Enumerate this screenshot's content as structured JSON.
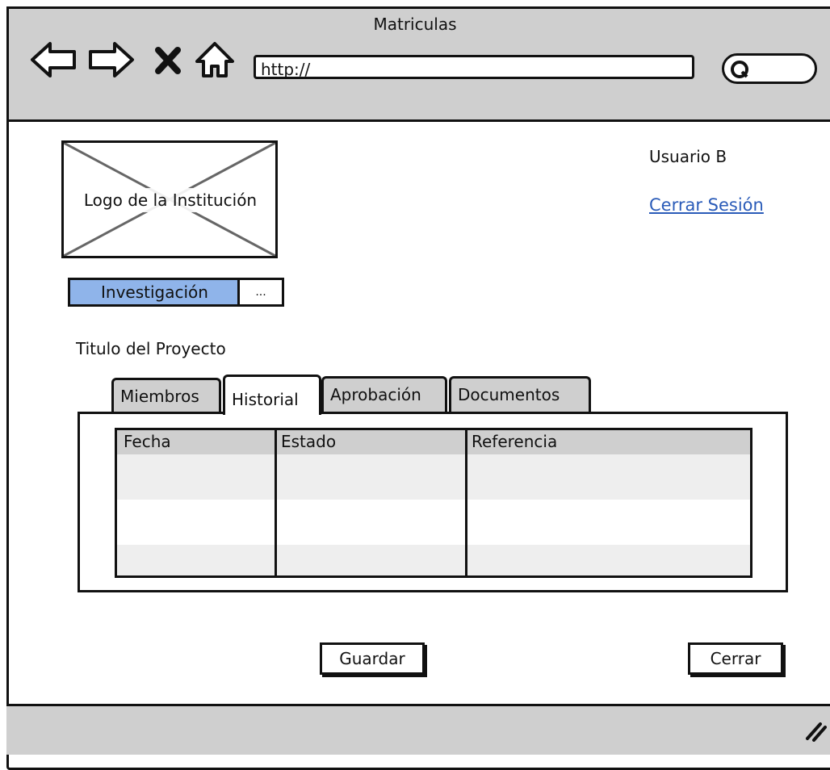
{
  "window": {
    "title": "Matriculas"
  },
  "browser": {
    "url": "http://",
    "nav_icons": [
      "back-arrow-icon",
      "forward-arrow-icon",
      "close-x-icon",
      "home-icon"
    ],
    "search_icon": "search-icon"
  },
  "header": {
    "logo_label": "Logo de la Institución",
    "user_name": "Usuario B",
    "logout_label": "Cerrar Sesión"
  },
  "section_switch": {
    "active_label": "Investigación",
    "more_label": "..."
  },
  "project": {
    "title": "Titulo del Proyecto"
  },
  "tabs": [
    {
      "label": "Miembros",
      "active": false
    },
    {
      "label": "Historial",
      "active": true
    },
    {
      "label": "Aprobación",
      "active": false
    },
    {
      "label": "Documentos",
      "active": false
    }
  ],
  "history_table": {
    "columns": [
      "Fecha",
      "Estado",
      "Referencia"
    ],
    "rows": []
  },
  "actions": {
    "save_label": "Guardar",
    "close_label": "Cerrar"
  },
  "colors": {
    "chrome": "#cfcfcf",
    "accent": "#8fb4ea",
    "link": "#2a5bb8"
  }
}
